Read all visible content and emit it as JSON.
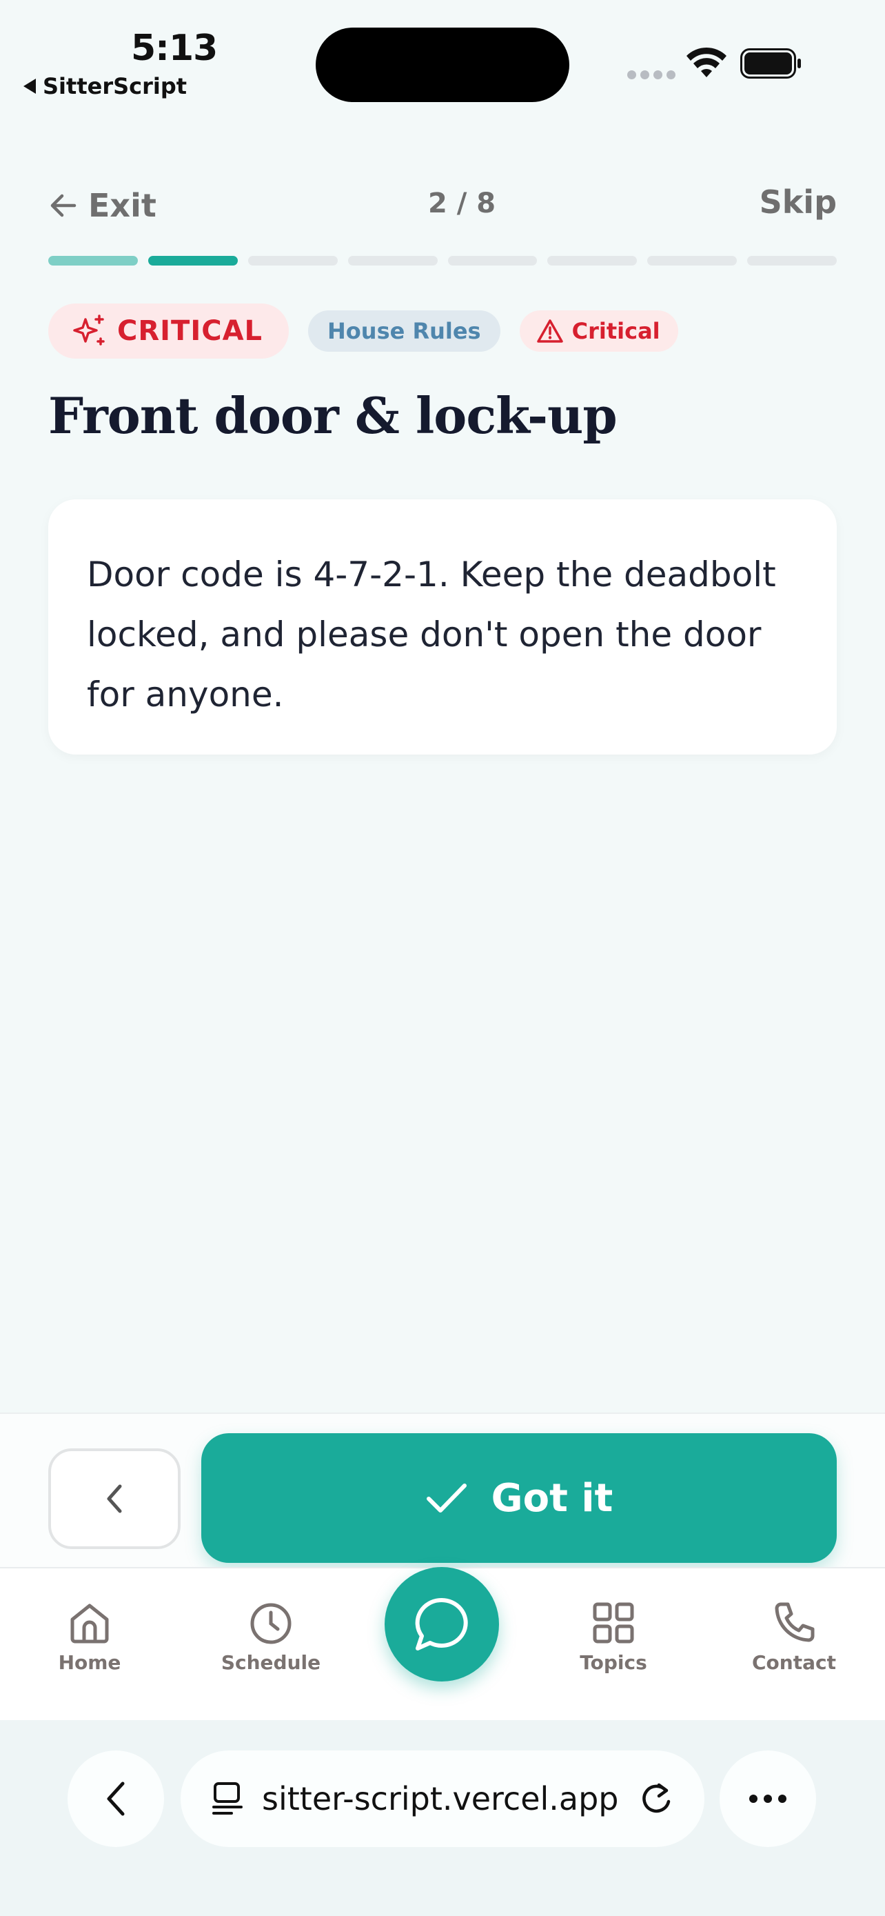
{
  "status_bar": {
    "time": "5:13",
    "back_app": "SitterScript"
  },
  "header": {
    "exit_label": "Exit",
    "progress": "2 / 8",
    "skip_label": "Skip",
    "current_step": 2,
    "total_steps": 8
  },
  "badges": {
    "priority": "CRITICAL",
    "category": "House Rules",
    "level": "Critical"
  },
  "card": {
    "title": "Front door & lock-up",
    "body": "Door code is 4-7-2-1. Keep the deadbolt locked, and please don't open the door for anyone."
  },
  "actions": {
    "got_it_label": "Got it"
  },
  "tabs": [
    {
      "label": "Home",
      "icon": "home-icon"
    },
    {
      "label": "Schedule",
      "icon": "clock-icon"
    },
    {
      "label": "Topics",
      "icon": "grid-icon"
    },
    {
      "label": "Contact",
      "icon": "phone-icon"
    }
  ],
  "browser": {
    "url": "sitter-script.vercel.app"
  },
  "colors": {
    "accent": "#1aab9a",
    "accent_light": "#7ecfc6",
    "critical": "#d7202f",
    "background": "#f3f9f9"
  }
}
